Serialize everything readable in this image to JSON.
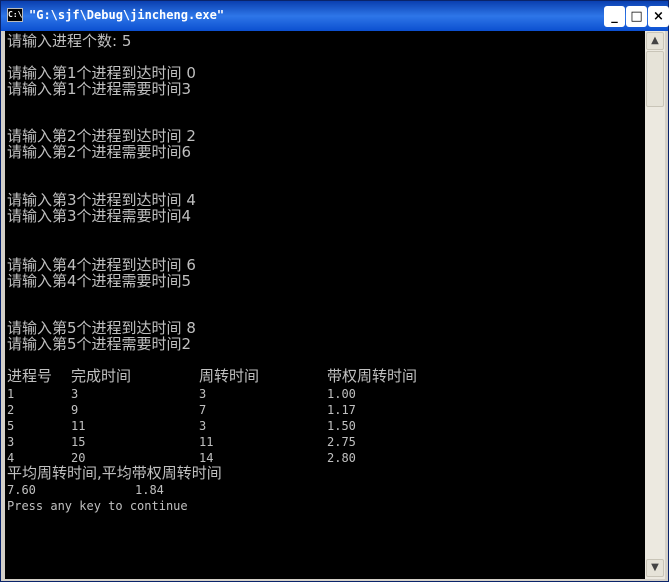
{
  "window": {
    "title": "\"G:\\sjf\\Debug\\jincheng.exe\"",
    "icon_text": "C:\\",
    "buttons": {
      "minimize": "_",
      "maximize": "□",
      "close": "×"
    }
  },
  "console": {
    "prompt_count": "请输入进程个数: 5",
    "processes": [
      {
        "arrive": "请输入第1个进程到达时间 0",
        "need": "请输入第1个进程需要时间3"
      },
      {
        "arrive": "请输入第2个进程到达时间 2",
        "need": "请输入第2个进程需要时间6"
      },
      {
        "arrive": "请输入第3个进程到达时间 4",
        "need": "请输入第3个进程需要时间4"
      },
      {
        "arrive": "请输入第4个进程到达时间 6",
        "need": "请输入第4个进程需要时间5"
      },
      {
        "arrive": "请输入第5个进程到达时间 8",
        "need": "请输入第5个进程需要时间2"
      }
    ],
    "table_headers": [
      "进程号",
      "完成时间",
      "周转时间",
      "带权周转时间"
    ],
    "table_rows": [
      [
        "1",
        "3",
        "3",
        "1.00"
      ],
      [
        "2",
        "9",
        "7",
        "1.17"
      ],
      [
        "5",
        "11",
        "3",
        "1.50"
      ],
      [
        "3",
        "15",
        "11",
        "2.75"
      ],
      [
        "4",
        "20",
        "14",
        "2.80"
      ]
    ],
    "avg_label": "平均周转时间,平均带权周转时间",
    "avg_turnaround": "7.60",
    "avg_weighted": "1.84",
    "press_key": "Press any key to continue"
  },
  "scrollbar": {
    "up_arrow": "▲",
    "down_arrow": "▼"
  }
}
